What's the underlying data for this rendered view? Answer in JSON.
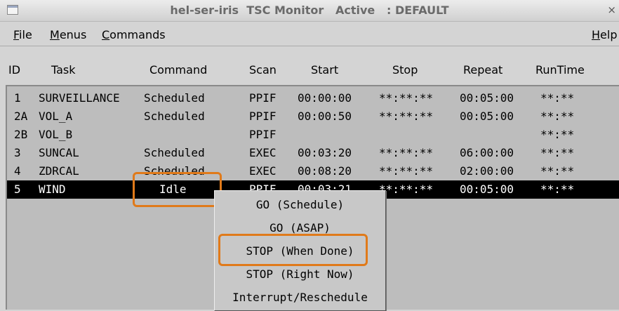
{
  "window": {
    "title": "hel-ser-iris  TSC Monitor   Active   : DEFAULT",
    "close_glyph": "×"
  },
  "menubar": {
    "items": [
      {
        "underline": "F",
        "rest": "ile"
      },
      {
        "underline": "M",
        "rest": "enus"
      },
      {
        "underline": "C",
        "rest": "ommands"
      },
      {
        "underline": "H",
        "rest": "elp"
      }
    ]
  },
  "columns": [
    "ID",
    "Task",
    "Command",
    "Scan",
    "Start",
    "Stop",
    "Repeat",
    "RunTime"
  ],
  "rows": [
    {
      "id": "1",
      "task": "SURVEILLANCE",
      "command": "Scheduled",
      "scan": "PPIF",
      "start": "00:00:00",
      "stop": "**:**:**",
      "repeat": "00:05:00",
      "runtime": "**:**"
    },
    {
      "id": "2A",
      "task": "VOL_A",
      "command": "Scheduled",
      "scan": "PPIF",
      "start": "00:00:50",
      "stop": "**:**:**",
      "repeat": "00:05:00",
      "runtime": "**:**"
    },
    {
      "id": "2B",
      "task": "VOL_B",
      "command": "",
      "scan": "PPIF",
      "start": "",
      "stop": "",
      "repeat": "",
      "runtime": "**:**"
    },
    {
      "id": "3",
      "task": "SUNCAL",
      "command": "Scheduled",
      "scan": "EXEC",
      "start": "00:03:20",
      "stop": "**:**:**",
      "repeat": "06:00:00",
      "runtime": "**:**"
    },
    {
      "id": "4",
      "task": "ZDRCAL",
      "command": "Scheduled",
      "scan": "EXEC",
      "start": "00:08:20",
      "stop": "**:**:**",
      "repeat": "02:00:00",
      "runtime": "**:**"
    },
    {
      "id": "5",
      "task": "WIND",
      "command": "Idle",
      "scan": "PPIF",
      "start": "00:03:21",
      "stop": "**:**:**",
      "repeat": "00:05:00",
      "runtime": "**:**"
    }
  ],
  "selected_row": 5,
  "context_menu": {
    "items": [
      "GO (Schedule)",
      "GO (ASAP)",
      "STOP (When Done)",
      "STOP (Right Now)",
      "Interrupt/Reschedule"
    ]
  },
  "colors": {
    "highlight": "#e07a1a",
    "selected_row_bg": "#000000",
    "selected_row_fg": "#ffffff"
  }
}
